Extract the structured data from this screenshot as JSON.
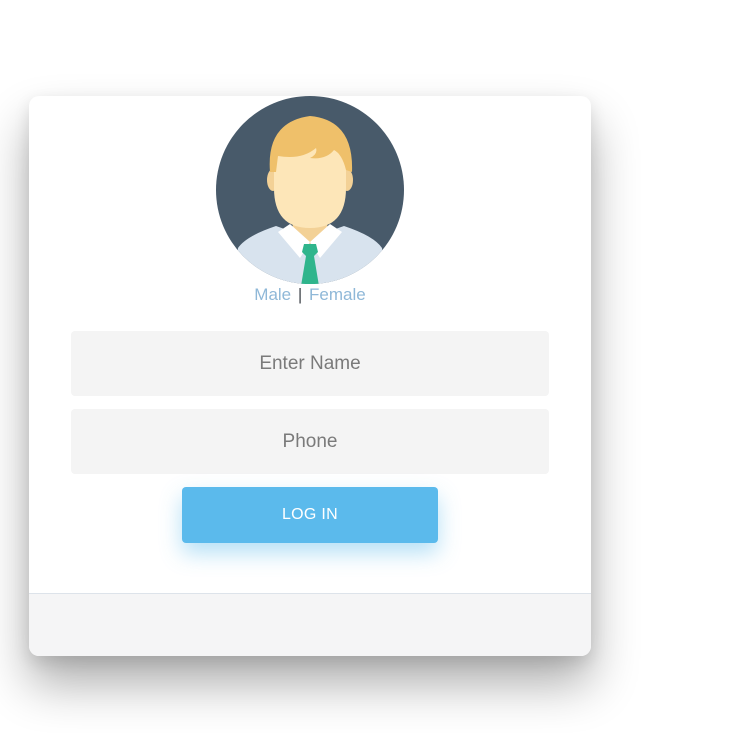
{
  "avatar": {
    "icon": "male-user-avatar-icon",
    "colors": {
      "background": "#485a6a",
      "hair": "#efc06a",
      "skin": "#fde6b8",
      "shirt": "#d8e3ee",
      "tie": "#2fb58c"
    }
  },
  "gender": {
    "male_label": "Male",
    "separator": "|",
    "female_label": "Female"
  },
  "form": {
    "name_placeholder": "Enter Name",
    "name_value": "",
    "phone_placeholder": "Phone",
    "phone_value": "",
    "login_label": "LOG IN"
  },
  "colors": {
    "accent": "#5bbaec",
    "link": "#8fb8d8",
    "field_background": "#f4f4f4",
    "footer_background": "#f5f5f6"
  }
}
